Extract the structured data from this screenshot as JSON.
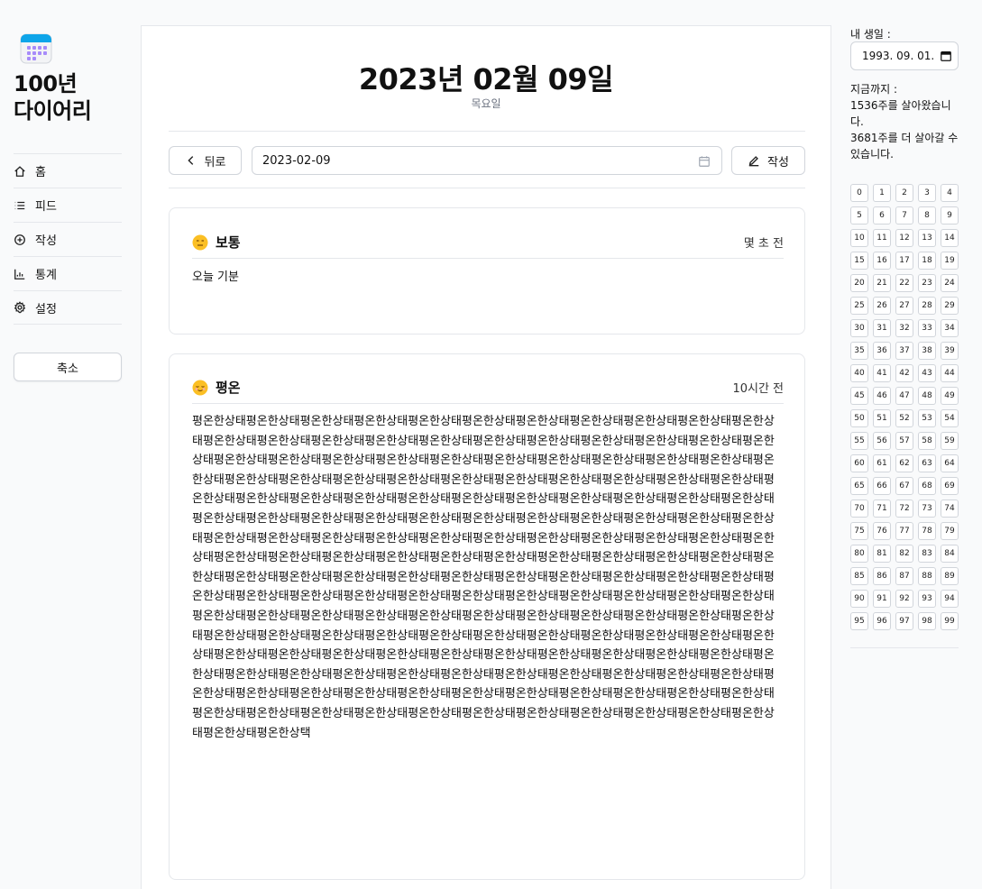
{
  "app": {
    "title_line1": "100년",
    "title_line2": "다이어리"
  },
  "sidebar": {
    "items": [
      {
        "label": "홈",
        "icon": "home-icon"
      },
      {
        "label": "피드",
        "icon": "list-icon"
      },
      {
        "label": "작성",
        "icon": "plus-circle-icon"
      },
      {
        "label": "통계",
        "icon": "chart-icon"
      },
      {
        "label": "설정",
        "icon": "gear-icon"
      }
    ],
    "collapse_label": "축소"
  },
  "main": {
    "date_title": "2023년 02월 09일",
    "weekday": "목요일",
    "back_label": "뒤로",
    "date_value": "2023-02-09",
    "write_label": "작성"
  },
  "entries": [
    {
      "mood": "보통",
      "time": "몇 초 전",
      "body": "오늘 기분"
    },
    {
      "mood": "평온",
      "time": "10시간 전",
      "body": "평온한상태평온한상태평온한상태평온한상태평온한상태평온한상태평온한상태평온한상태평온한상태평온한상태평온한상태평온한상태평온한상태평온한상태평온한상태평온한상태평온한상태평온한상태평온한상태평온한상태평온한상태평온한상태평온한상태평온한상태평온한상태평온한상태평온한상태평온한상태평온한상태평온한상태평온한상태평온한상태평온한상태평온한상태평온한상태평온한상태평온한상태평온한상태평온한상태평온한상태평온한상태평온한상태평온한상태평온한상태평온한상태평온한상태평온한상태평온한상태평온한상태평온한상태평온한상태평온한상태평온한상태평온한상태평온한상태평온한상태평온한상태평온한상태평온한상태평온한상태평온한상태평온한상태평온한상태평온한상태평온한상태평온한상태평온한상태평온한상태평온한상태평온한상태평온한상태평온한상태평온한상태평온한상태평온한상태평온한상태평온한상태평온한상태평온한상태평온한상태평온한상태평온한상태평온한상태평온한상태평온한상태평온한상태평온한상태평온한상태평온한상태평온한상태평온한상태평온한상태평온한상태평온한상태평온한상태평온한상태평온한상태평온한상태평온한상태평온한상태평온한상태평온한상태평온한상태평온한상태평온한상태평온한상태평온한상태평온한상태평온한상태평온한상태평온한상태평온한상태평온한상태평온한상태평온한상태평온한상태평온한상태평온한상태평온한상태평온한상태평온한상태평온한상태평온한상태평온한상태평온한상태평온한상태평온한상태평온한상태평온한상태평온한상태평온한상태평온한상태평온한상태평온한상태평온한상태평온한상태평온한상태평온한상태평온한상태평온한상태평온한상태평온한상태평온한상태평온한상태평온한상태평온한상태평온한상태평온한상태평온한상태평온한상태평온한상태평온한상태평온한상태평온한상태평온한상태평온한상태평온한상태평온한상태평온한상태평온한상태평온한상태평온한상태평온한상태평온한상태평온한상태평온한상태평온한상태평온한상태평온한상태평온한상태평온한상태평온한상태평온한상태평온한상태평온한상택"
    }
  ],
  "right": {
    "birthday_label": "내 생일 :",
    "birthday_value": "1993. 09. 01.",
    "life_label": "지금까지 :",
    "lived_text": "1536주를 살아왔습니다.",
    "remaining_text": "3681주를 더 살아갈 수 있습니다.",
    "year_cells": [
      "0",
      "1",
      "2",
      "3",
      "4",
      "5",
      "6",
      "7",
      "8",
      "9",
      "10",
      "11",
      "12",
      "13",
      "14",
      "15",
      "16",
      "17",
      "18",
      "19",
      "20",
      "21",
      "22",
      "23",
      "24",
      "25",
      "26",
      "27",
      "28",
      "29",
      "30",
      "31",
      "32",
      "33",
      "34",
      "35",
      "36",
      "37",
      "38",
      "39",
      "40",
      "41",
      "42",
      "43",
      "44",
      "45",
      "46",
      "47",
      "48",
      "49",
      "50",
      "51",
      "52",
      "53",
      "54",
      "55",
      "56",
      "57",
      "58",
      "59",
      "60",
      "61",
      "62",
      "63",
      "64",
      "65",
      "66",
      "67",
      "68",
      "69",
      "70",
      "71",
      "72",
      "73",
      "74",
      "75",
      "76",
      "77",
      "78",
      "79",
      "80",
      "81",
      "82",
      "83",
      "84",
      "85",
      "86",
      "87",
      "88",
      "89",
      "90",
      "91",
      "92",
      "93",
      "94",
      "95",
      "96",
      "97",
      "98",
      "99"
    ]
  },
  "colors": {
    "accent": "#0ea5e9",
    "border": "#e5e7eb",
    "muted": "#6b7280"
  }
}
